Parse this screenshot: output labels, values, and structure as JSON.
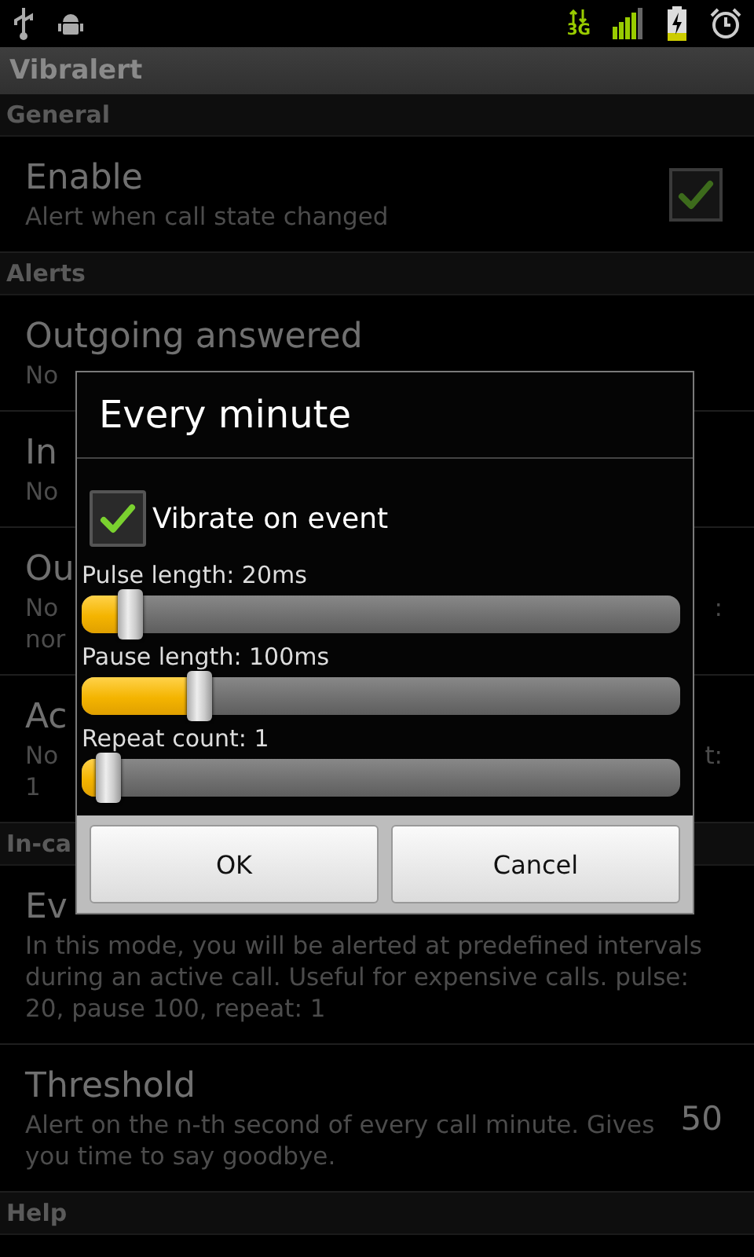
{
  "status_bar": {
    "network": "3G"
  },
  "app_bar": {
    "title": "Vibralert"
  },
  "sections": [
    {
      "title": "General",
      "items": [
        {
          "kind": "checkbox",
          "title": "Enable",
          "summary": "Alert when call state changed",
          "checked": true
        }
      ]
    },
    {
      "title": "Alerts",
      "items": [
        {
          "kind": "plain",
          "title": "Outgoing answered",
          "summary": "No"
        },
        {
          "kind": "plain",
          "title": "In",
          "summary": "No"
        },
        {
          "kind": "plain",
          "title": "Ou",
          "summary": "No",
          "summary_right": ":",
          "summary_2": "nor"
        },
        {
          "kind": "plain",
          "title": "Ac",
          "summary": "No",
          "summary_right": "t:",
          "summary_2": "1"
        }
      ]
    },
    {
      "title": "In-ca",
      "items": [
        {
          "kind": "plain",
          "title": "Ev",
          "summary": "In this mode, you will be alerted at predefined intervals during an active call. Useful for expensive calls. pulse: 20, pause 100, repeat: 1"
        },
        {
          "kind": "value",
          "title": "Threshold",
          "summary": "Alert on the n-th second of every call minute. Gives you time to say goodbye.",
          "value": "50"
        }
      ]
    },
    {
      "title": "Help"
    }
  ],
  "dialog": {
    "title": "Every minute",
    "checkbox": {
      "label": "Vibrate on event",
      "checked": true
    },
    "sliders": [
      {
        "label": "Pulse length: 20ms",
        "level": 0.06
      },
      {
        "label": "Pause length: 100ms",
        "level": 0.18
      },
      {
        "label": "Repeat count: 1",
        "level": 0.02
      }
    ],
    "buttons": [
      "OK",
      "Cancel"
    ]
  }
}
